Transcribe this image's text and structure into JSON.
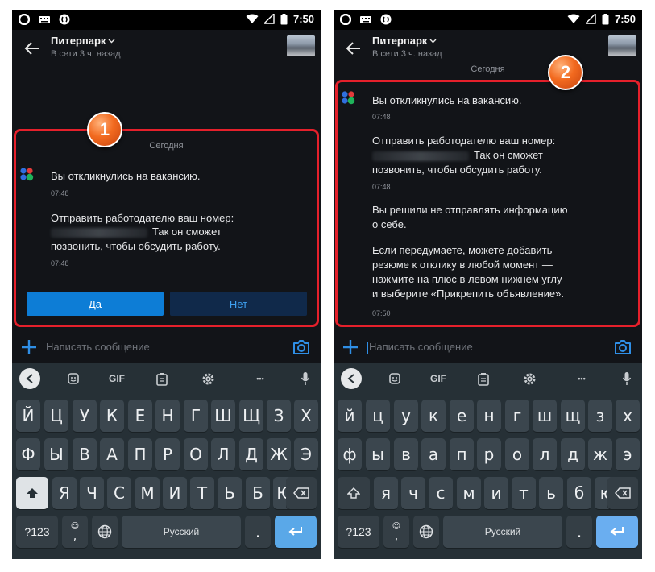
{
  "status": {
    "time": "7:50"
  },
  "chat": {
    "contact_name": "Питерпарк",
    "last_seen": "В сети 3 ч. назад",
    "date_label": "Сегодня",
    "msg1": "Вы откликнулись на вакансию.",
    "msg1_time": "07:48",
    "msg2_line1": "Отправить работодателю ваш номер:",
    "msg2_line2": "Так он сможет",
    "msg2_line3": "позвонить, чтобы обсудить работу.",
    "msg2_time": "07:48",
    "yes_label": "Да",
    "no_label": "Нет",
    "msg3_line1": "Вы решили не отправлять информацию",
    "msg3_line2": "о себе.",
    "msg3_line3": "Если передумаете, можете добавить",
    "msg3_line4": "резюме к отклику в любой момент —",
    "msg3_line5": "нажмите на плюс в левом нижнем углу",
    "msg3_line6": "и выберите «Прикрепить объявление».",
    "msg3_time": "07:50"
  },
  "composer": {
    "placeholder": "Написать сообщение"
  },
  "badges": {
    "first": "1",
    "second": "2"
  },
  "keyboard": {
    "gif": "GIF",
    "more": "•••",
    "row1": [
      "Й",
      "Ц",
      "У",
      "К",
      "Е",
      "Н",
      "Г",
      "Ш",
      "Щ",
      "З",
      "Х"
    ],
    "row2": [
      "Ф",
      "Ы",
      "В",
      "А",
      "П",
      "Р",
      "О",
      "Л",
      "Д",
      "Ж",
      "Э"
    ],
    "row3": [
      "Я",
      "Ч",
      "С",
      "М",
      "И",
      "Т",
      "Ь",
      "Б",
      "Ю"
    ],
    "row1_lower": [
      "й",
      "ц",
      "у",
      "к",
      "е",
      "н",
      "г",
      "ш",
      "щ",
      "з",
      "х"
    ],
    "row2_lower": [
      "ф",
      "ы",
      "в",
      "а",
      "п",
      "р",
      "о",
      "л",
      "д",
      "ж",
      "э"
    ],
    "row3_lower": [
      "я",
      "ч",
      "с",
      "м",
      "и",
      "т",
      "ь",
      "б",
      "ю"
    ],
    "num_label": "?123",
    "comma": ",",
    "emoji": "☺",
    "space_label": "Русский",
    "period": "."
  },
  "colors": {
    "accent": "#0d7dd6",
    "highlight": "#e5202b",
    "badge": "#f26a1f"
  }
}
